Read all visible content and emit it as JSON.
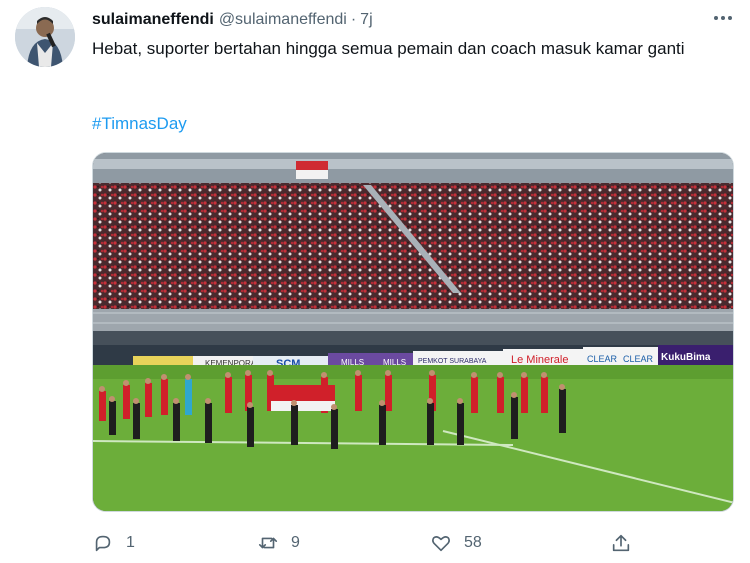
{
  "tweet": {
    "author_name": "sulaimaneffendi",
    "handle": "@sulaimaneffendi",
    "separator": "·",
    "time": "7j",
    "text": "Hebat, suporter bertahan hingga semua pemain dan coach masuk kamar ganti",
    "hashtag": "#TimnasDay"
  },
  "media": {
    "ad_boards": [
      "KEMENPORA",
      "SCM",
      "MILLS",
      "MILLS",
      "PEMKOT SURABAYA",
      "Le Minerale",
      "CLEAR",
      "CLEAR",
      "KukuBima"
    ]
  },
  "actions": {
    "reply_count": "1",
    "retweet_count": "9",
    "like_count": "58"
  },
  "colors": {
    "link": "#1d9bf0",
    "muted": "#536471",
    "pitch": "#6cae3a",
    "jersey": "#d0202a"
  }
}
